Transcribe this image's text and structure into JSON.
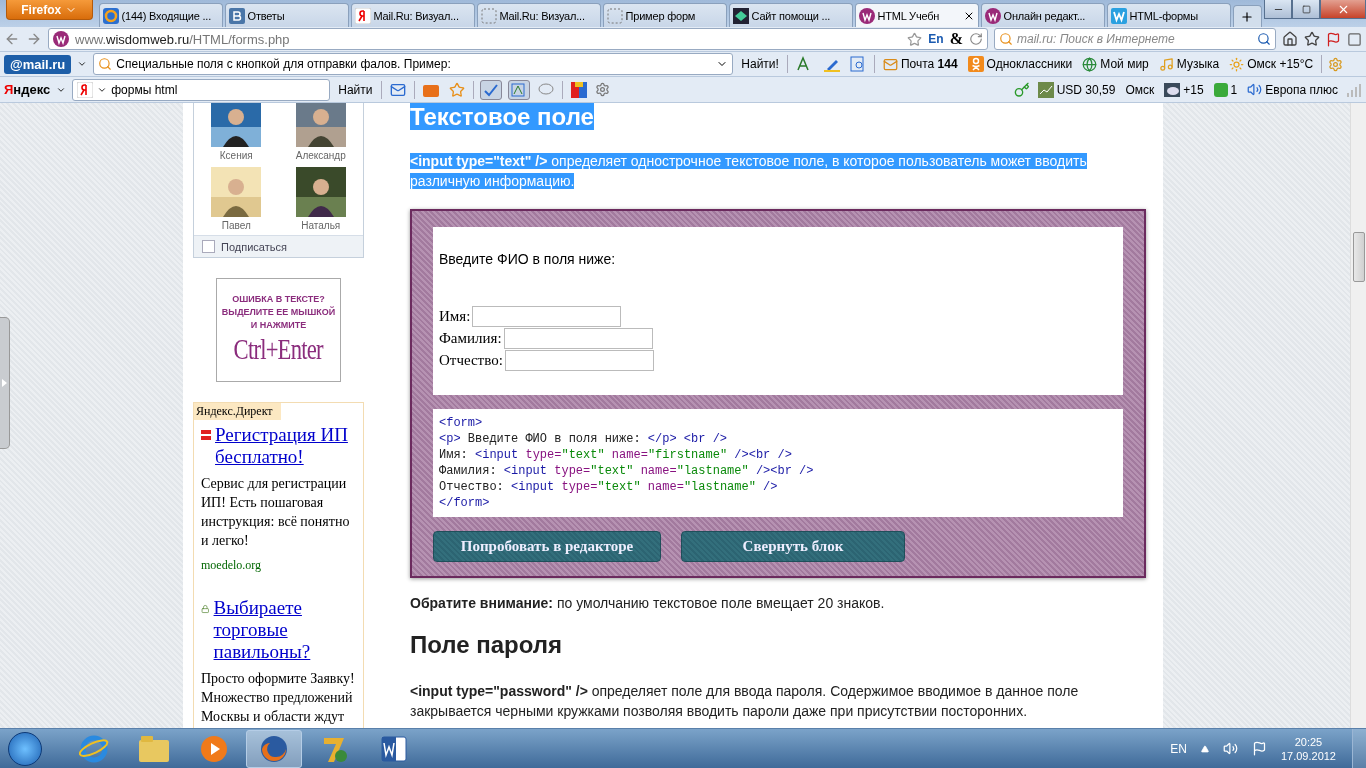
{
  "tabs": {
    "menu_button": "Firefox",
    "items": [
      {
        "title": "(144) Входящие ...",
        "kind": "mail",
        "selected": false
      },
      {
        "title": "Ответы",
        "kind": "vk",
        "selected": false
      },
      {
        "title": "Mail.Ru: Визуал...",
        "kind": "yandex",
        "selected": false
      },
      {
        "title": "Mail.Ru: Визуал...",
        "kind": "blank",
        "selected": false
      },
      {
        "title": "Пример форм",
        "kind": "blank",
        "selected": false
      },
      {
        "title": "Сайт помощи ...",
        "kind": "site",
        "selected": false
      },
      {
        "title": "HTML Учебн",
        "kind": "wisdom",
        "selected": true
      },
      {
        "title": "Онлайн редакт...",
        "kind": "wisdom",
        "selected": false
      },
      {
        "title": "HTML-формы",
        "kind": "word",
        "selected": false
      }
    ]
  },
  "nav": {
    "url_prefix": "www.",
    "url_domain": "wisdomweb.ru",
    "url_path": "/HTML/forms.php",
    "lang": "En",
    "amp": "&",
    "search_placeholder": "mail.ru: Поиск в Интернете"
  },
  "mail_bar": {
    "logo": "@mail.ru",
    "search_value": "Специальные поля с кнопкой для отправки фалов. Пример:",
    "find_button": "Найти!",
    "links": [
      {
        "label": "Почта **144**",
        "kind": "mail"
      },
      {
        "label": "Одноклассники",
        "kind": "ok"
      },
      {
        "label": "Мой мир",
        "kind": "world"
      },
      {
        "label": "Музыка",
        "kind": "music"
      },
      {
        "label": "Омск +15°C",
        "kind": "weather"
      }
    ]
  },
  "yandex_bar": {
    "logo": "Яндекс",
    "search_value": "формы html",
    "find_button": "Найти",
    "widgets": [
      {
        "label": "USD 30,59",
        "kind": "currency"
      },
      {
        "label": "Омск",
        "kind": "city"
      },
      {
        "label": "+15",
        "kind": "weather"
      },
      {
        "label": "1",
        "kind": "counter"
      },
      {
        "label": "Европа плюс",
        "kind": "radio"
      }
    ]
  },
  "sidebar": {
    "friends": [
      {
        "name": "Ксения"
      },
      {
        "name": "Александр"
      },
      {
        "name": "Павел"
      },
      {
        "name": "Наталья"
      }
    ],
    "subscribe": {
      "label": "Подписаться",
      "checked": false
    },
    "banner": [
      "ОШИБКА В ТЕКСТЕ?",
      "ВЫДЕЛИТЕ ЕЕ МЫШКОЙ",
      "И НАЖМИТЕ",
      "Ctrl+Enter"
    ],
    "direct": {
      "label": "Яндекс.Директ",
      "ads": [
        {
          "kind": "flag",
          "title": "Регистрация ИП бесплатно!",
          "text": "Сервис для регистрации ИП! Есть пошаговая инструкция: всё понятно и легко!",
          "domain": "moedelo.org"
        },
        {
          "kind": "lock",
          "title": "Выбираете торговые павильоны?",
          "text": "Просто оформите Заявку! Множество предложений Москвы и области ждут"
        }
      ]
    }
  },
  "main": {
    "heading": {
      "text": "Текстовое поле",
      "highlighted": true
    },
    "intro": {
      "text": "**<input type=\"text\" />** определяет однострочное текстовое поле, в которое пользователь может вводить различную информацию.",
      "highlighted": true
    },
    "demo": {
      "prompt": "Введите ФИО в поля ниже:",
      "fields": [
        {
          "label": "Имя:"
        },
        {
          "label": "Фамилия:"
        },
        {
          "label": "Отчество:"
        }
      ],
      "code": [
        [
          {
            "kind": "tag",
            "text": "<form>"
          }
        ],
        [
          {
            "kind": "tag",
            "text": "<p>"
          },
          {
            "kind": "text",
            "text": " Введите ФИО в поля ниже: "
          },
          {
            "kind": "tag",
            "text": "</p> <br />"
          }
        ],
        [
          {
            "kind": "text",
            "text": "Имя: "
          },
          {
            "kind": "tag",
            "text": "<input"
          },
          {
            "kind": "attr",
            "text": " type="
          },
          {
            "kind": "value",
            "text": "\"text\""
          },
          {
            "kind": "attr",
            "text": " name="
          },
          {
            "kind": "value",
            "text": "\"firstname\""
          },
          {
            "kind": "tag",
            "text": " /><br />"
          }
        ],
        [
          {
            "kind": "text",
            "text": "Фамилия: "
          },
          {
            "kind": "tag",
            "text": "<input"
          },
          {
            "kind": "attr",
            "text": " type="
          },
          {
            "kind": "value",
            "text": "\"text\""
          },
          {
            "kind": "attr",
            "text": " name="
          },
          {
            "kind": "value",
            "text": "\"lastname\""
          },
          {
            "kind": "tag",
            "text": " /><br />"
          }
        ],
        [
          {
            "kind": "text",
            "text": "Отчество: "
          },
          {
            "kind": "tag",
            "text": "<input"
          },
          {
            "kind": "attr",
            "text": " type="
          },
          {
            "kind": "value",
            "text": "\"text\""
          },
          {
            "kind": "attr",
            "text": " name="
          },
          {
            "kind": "value",
            "text": "\"lastname\""
          },
          {
            "kind": "tag",
            "text": " />"
          }
        ],
        [
          {
            "kind": "tag",
            "text": "</form>"
          }
        ]
      ],
      "buttons": [
        "Попробовать в редакторе",
        "Свернуть блок"
      ]
    },
    "note": "**Обратите внимание:** по умолчанию текстовое поле вмещает 20 знаков.",
    "heading2": "Поле пароля",
    "para2": "**<input type=\"password\" />** определяет поле для ввода пароля. Содержимое вводимое в данное поле закрывается черными кружками позволяя вводить пароли даже при присутствии посторонних."
  },
  "taskbar": {
    "apps": [
      {
        "kind": "ie",
        "active": false
      },
      {
        "kind": "folder",
        "active": false
      },
      {
        "kind": "media",
        "active": false
      },
      {
        "kind": "firefox",
        "active": true
      },
      {
        "kind": "seven",
        "active": false
      },
      {
        "kind": "word",
        "active": false
      }
    ],
    "lang": "EN",
    "time": "20:25",
    "date": "17.09.2012"
  }
}
